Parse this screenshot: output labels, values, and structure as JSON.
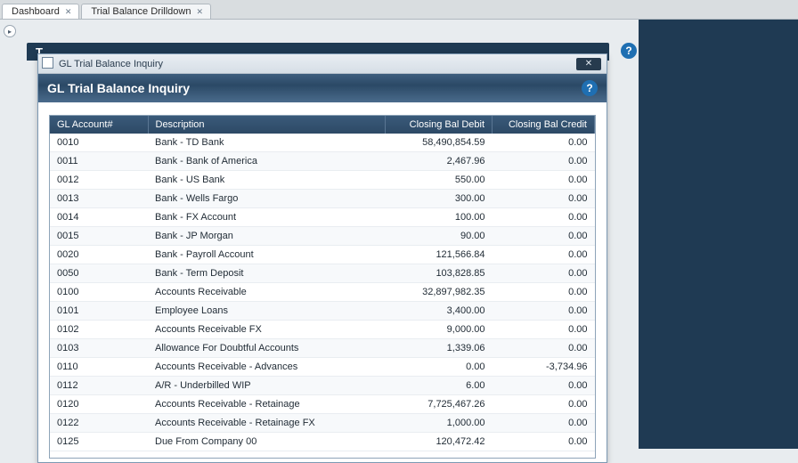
{
  "tabs": [
    {
      "label": "Dashboard"
    },
    {
      "label": "Trial Balance Drilldown"
    }
  ],
  "underlay_title_prefix": "T",
  "dialog": {
    "titlebar": "GL Trial Balance Inquiry",
    "header": "GL Trial Balance Inquiry"
  },
  "columns": {
    "acct": "GL Account#",
    "desc": "Description",
    "debit": "Closing Bal Debit",
    "credit": "Closing Bal Credit"
  },
  "rows": [
    {
      "acct": "0010",
      "desc": "Bank - TD Bank",
      "debit": "58,490,854.59",
      "credit": "0.00"
    },
    {
      "acct": "0011",
      "desc": "Bank - Bank of America",
      "debit": "2,467.96",
      "credit": "0.00"
    },
    {
      "acct": "0012",
      "desc": "Bank - US Bank",
      "debit": "550.00",
      "credit": "0.00"
    },
    {
      "acct": "0013",
      "desc": "Bank - Wells Fargo",
      "debit": "300.00",
      "credit": "0.00"
    },
    {
      "acct": "0014",
      "desc": "Bank - FX Account",
      "debit": "100.00",
      "credit": "0.00"
    },
    {
      "acct": "0015",
      "desc": "Bank - JP Morgan",
      "debit": "90.00",
      "credit": "0.00"
    },
    {
      "acct": "0020",
      "desc": "Bank - Payroll Account",
      "debit": "121,566.84",
      "credit": "0.00"
    },
    {
      "acct": "0050",
      "desc": "Bank - Term Deposit",
      "debit": "103,828.85",
      "credit": "0.00"
    },
    {
      "acct": "0100",
      "desc": "Accounts Receivable",
      "debit": "32,897,982.35",
      "credit": "0.00"
    },
    {
      "acct": "0101",
      "desc": "Employee Loans",
      "debit": "3,400.00",
      "credit": "0.00"
    },
    {
      "acct": "0102",
      "desc": "Accounts Receivable FX",
      "debit": "9,000.00",
      "credit": "0.00"
    },
    {
      "acct": "0103",
      "desc": "Allowance For Doubtful Accounts",
      "debit": "1,339.06",
      "credit": "0.00"
    },
    {
      "acct": "0110",
      "desc": "Accounts Receivable - Advances",
      "debit": "0.00",
      "credit": "-3,734.96"
    },
    {
      "acct": "0112",
      "desc": "A/R - Underbilled WIP",
      "debit": "6.00",
      "credit": "0.00"
    },
    {
      "acct": "0120",
      "desc": "Accounts Receivable - Retainage",
      "debit": "7,725,467.26",
      "credit": "0.00"
    },
    {
      "acct": "0122",
      "desc": "Accounts Receivable - Retainage FX",
      "debit": "1,000.00",
      "credit": "0.00"
    },
    {
      "acct": "0125",
      "desc": "Due From Company 00",
      "debit": "120,472.42",
      "credit": "0.00"
    }
  ],
  "help_glyph": "?"
}
